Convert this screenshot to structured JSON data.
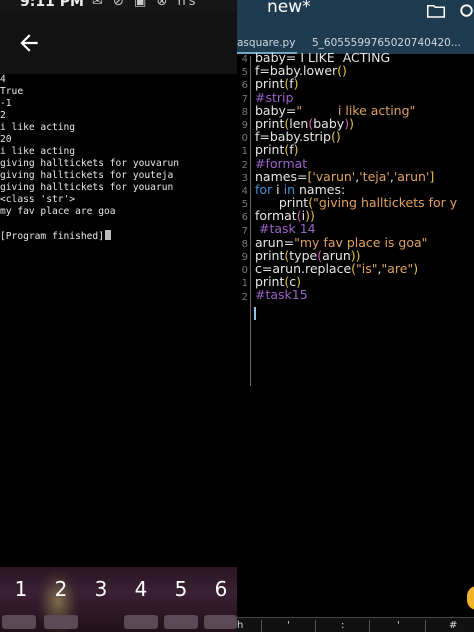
{
  "status": {
    "time": "9:11 PM",
    "icons": "✉ ⊘ ▣ ⊗ ns"
  },
  "console": {
    "lines": [
      "4",
      "True",
      "-1",
      "2",
      "i like acting",
      "20",
      "i like acting",
      "giving halltickets for youvarun",
      "giving halltickets for youteja",
      "giving halltickets for youarun",
      "<class 'str'>",
      "my fav place are goa",
      "",
      "[Program finished]"
    ]
  },
  "keybar": {
    "keys": [
      "1",
      "2",
      "3",
      "4",
      "5",
      "6"
    ]
  },
  "editor": {
    "title": "new*",
    "tabs": [
      "asquare.py",
      "5_6055599765020740420..."
    ],
    "gutter": [
      "4",
      "5",
      "6",
      "7",
      "8",
      "9",
      "0",
      "1",
      "2",
      "3",
      "4",
      "5",
      "6",
      "7",
      "8",
      "9",
      "0",
      "1",
      "2"
    ],
    "code": [
      [
        {
          "t": "baby= I LIKE  ACTING",
          "c": "plain"
        }
      ],
      [
        {
          "t": "f=baby.lower",
          "c": "plain"
        },
        {
          "t": "()",
          "c": "paren1"
        }
      ],
      [
        {
          "t": "print",
          "c": "plain"
        },
        {
          "t": "(",
          "c": "paren1"
        },
        {
          "t": "f",
          "c": "plain"
        },
        {
          "t": ")",
          "c": "paren1"
        }
      ],
      [
        {
          "t": "#strip",
          "c": "cm"
        }
      ],
      [
        {
          "t": "baby=",
          "c": "plain"
        },
        {
          "t": "\"         i like acting\"",
          "c": "str"
        }
      ],
      [
        {
          "t": "print",
          "c": "plain"
        },
        {
          "t": "(",
          "c": "paren1"
        },
        {
          "t": "len",
          "c": "plain"
        },
        {
          "t": "(",
          "c": "paren2"
        },
        {
          "t": "baby",
          "c": "plain"
        },
        {
          "t": ")",
          "c": "paren2"
        },
        {
          "t": ")",
          "c": "paren1"
        }
      ],
      [
        {
          "t": "f=baby.strip",
          "c": "plain"
        },
        {
          "t": "()",
          "c": "paren1"
        }
      ],
      [
        {
          "t": "print",
          "c": "plain"
        },
        {
          "t": "(",
          "c": "paren1"
        },
        {
          "t": "f",
          "c": "plain"
        },
        {
          "t": ")",
          "c": "paren1"
        }
      ],
      [
        {
          "t": "#format",
          "c": "cm"
        }
      ],
      [
        {
          "t": "names=",
          "c": "plain"
        },
        {
          "t": "[",
          "c": "paren1"
        },
        {
          "t": "'varun'",
          "c": "str"
        },
        {
          "t": ",",
          "c": "plain"
        },
        {
          "t": "'teja'",
          "c": "str"
        },
        {
          "t": ",",
          "c": "plain"
        },
        {
          "t": "'arun'",
          "c": "str"
        },
        {
          "t": "]",
          "c": "paren1"
        }
      ],
      [
        {
          "t": "for",
          "c": "kw"
        },
        {
          "t": " i ",
          "c": "plain"
        },
        {
          "t": "in",
          "c": "kw"
        },
        {
          "t": " names:",
          "c": "plain"
        }
      ],
      [
        {
          "t": "      print",
          "c": "plain"
        },
        {
          "t": "(",
          "c": "paren1"
        },
        {
          "t": "\"giving halltickets for y",
          "c": "str"
        }
      ],
      [
        {
          "t": "format",
          "c": "plain"
        },
        {
          "t": "(",
          "c": "paren2"
        },
        {
          "t": "i",
          "c": "plain"
        },
        {
          "t": "))",
          "c": "paren1"
        }
      ],
      [
        {
          "t": " #task 14",
          "c": "cm"
        }
      ],
      [
        {
          "t": "arun=",
          "c": "plain"
        },
        {
          "t": "\"my fav place is goa\"",
          "c": "str"
        }
      ],
      [
        {
          "t": "print",
          "c": "plain"
        },
        {
          "t": "(",
          "c": "paren1"
        },
        {
          "t": "type",
          "c": "plain"
        },
        {
          "t": "(",
          "c": "paren2"
        },
        {
          "t": "arun",
          "c": "plain"
        },
        {
          "t": "))",
          "c": "paren1"
        }
      ],
      [
        {
          "t": "c=arun.replace",
          "c": "plain"
        },
        {
          "t": "(",
          "c": "paren1"
        },
        {
          "t": "\"is\"",
          "c": "str"
        },
        {
          "t": ",",
          "c": "plain"
        },
        {
          "t": "\"are\"",
          "c": "str"
        },
        {
          "t": ")",
          "c": "paren1"
        }
      ],
      [
        {
          "t": "print",
          "c": "plain"
        },
        {
          "t": "(",
          "c": "paren1"
        },
        {
          "t": "c",
          "c": "plain"
        },
        {
          "t": ")",
          "c": "paren1"
        }
      ],
      [
        {
          "t": "#task15",
          "c": "cm"
        }
      ]
    ]
  },
  "bottom_keys": [
    "h",
    "'",
    ":",
    "'",
    "#"
  ]
}
